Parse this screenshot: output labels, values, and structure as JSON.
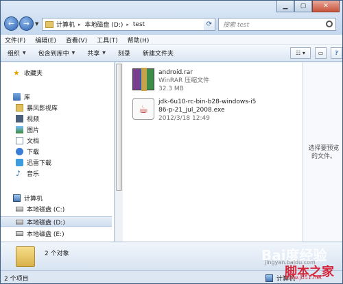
{
  "address": {
    "crumbs": [
      "计算机",
      "本地磁盘 (D:)",
      "test"
    ]
  },
  "search": {
    "placeholder": "搜索 test"
  },
  "menu": [
    "文件(F)",
    "编辑(E)",
    "查看(V)",
    "工具(T)",
    "帮助(H)"
  ],
  "toolbar": {
    "organize": "组织",
    "include": "包含到库中",
    "share": "共享",
    "burn": "刻录",
    "new_folder": "新建文件夹"
  },
  "sidebar": {
    "favorites": "收藏夹",
    "libraries": "库",
    "lib_items": [
      "暴风影视库",
      "视频",
      "图片",
      "文档",
      "下载",
      "迅雷下载",
      "音乐"
    ],
    "computer": "计算机",
    "drives": [
      "本地磁盘 (C:)",
      "本地磁盘 (D:)",
      "本地磁盘 (E:)"
    ]
  },
  "files": [
    {
      "name": "android.rar",
      "type": "WinRAR 压缩文件",
      "meta": "32.3 MB"
    },
    {
      "name": "jdk-6u10-rc-bin-b28-windows-i586-p-21_jul_2008.exe",
      "name_line1": "jdk-6u10-rc-bin-b28-windows-i5",
      "name_line2": "86-p-21_jul_2008.exe",
      "meta": "2012/3/18 12:49"
    }
  ],
  "preview": {
    "text": "选择要预览的文件。"
  },
  "details": {
    "count": "2 个对象"
  },
  "status": {
    "items": "2 个项目",
    "location": "计算机"
  },
  "watermark": {
    "a": "Bai度经验",
    "b": "jingyan.baidu.com",
    "c": "脚本之家",
    "d": "www.jb51.net"
  }
}
